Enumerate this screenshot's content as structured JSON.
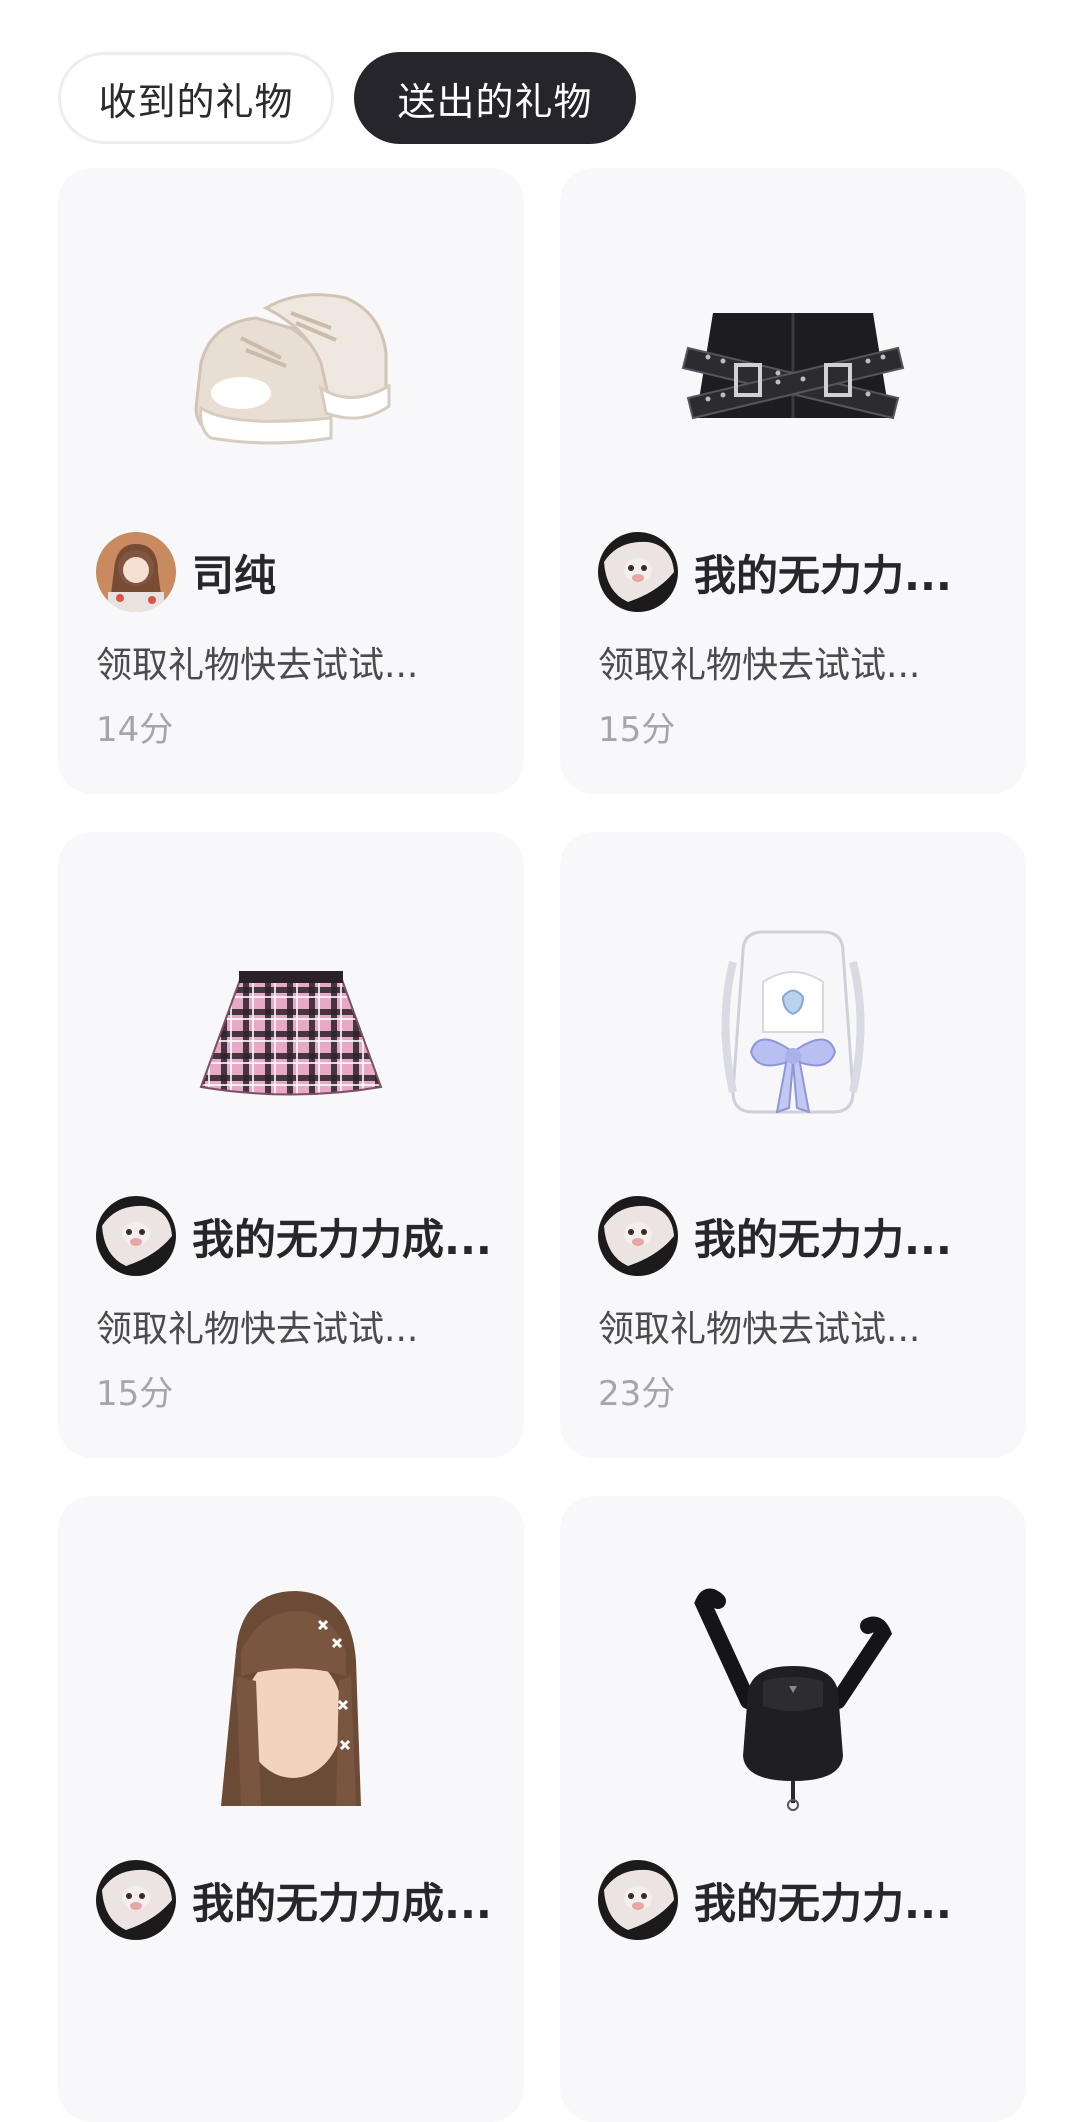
{
  "tabs": {
    "received": "收到的礼物",
    "sent": "送出的礼物"
  },
  "gifts": [
    {
      "item_icon": "sneakers-icon",
      "sender_name": "司纯",
      "message": "领取礼物快去试试...",
      "time": "14分"
    },
    {
      "item_icon": "belted-skirt-icon",
      "sender_name": "我的无力力...",
      "message": "领取礼物快去试试...",
      "time": "15分"
    },
    {
      "item_icon": "plaid-skirt-icon",
      "sender_name": "我的无力力成...",
      "message": "领取礼物快去试试...",
      "time": "15分"
    },
    {
      "item_icon": "bow-backpack-icon",
      "sender_name": "我的无力力...",
      "message": "领取礼物快去试试...",
      "time": "23分"
    },
    {
      "item_icon": "braided-hair-icon",
      "sender_name": "我的无力力成...",
      "message": "",
      "time": ""
    },
    {
      "item_icon": "black-backpack-icon",
      "sender_name": "我的无力力...",
      "message": "",
      "time": ""
    }
  ]
}
